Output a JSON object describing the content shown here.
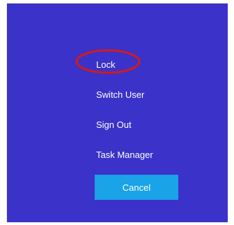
{
  "menu": {
    "items": [
      {
        "label": "Lock"
      },
      {
        "label": "Switch User"
      },
      {
        "label": "Sign Out"
      },
      {
        "label": "Task Manager"
      }
    ],
    "cancel_label": "Cancel"
  },
  "colors": {
    "background": "#3b32c9",
    "cancel_button": "#1aa3e6",
    "annotation": "#d41a1a",
    "text": "#ffffff"
  }
}
